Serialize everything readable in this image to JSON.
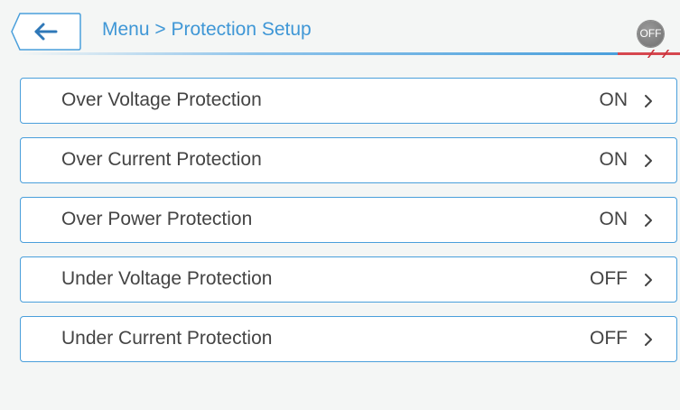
{
  "header": {
    "breadcrumb": "Menu > Protection Setup",
    "power_badge": "OFF",
    "back_icon": "arrow-left-icon"
  },
  "colors": {
    "accent": "#4a9fdb",
    "badge": "#7a7a7a",
    "alert": "#d6474f"
  },
  "items": [
    {
      "label": "Over Voltage Protection",
      "value": "ON"
    },
    {
      "label": "Over Current Protection",
      "value": "ON"
    },
    {
      "label": "Over Power Protection",
      "value": "ON"
    },
    {
      "label": "Under Voltage Protection",
      "value": "OFF"
    },
    {
      "label": "Under Current Protection",
      "value": "OFF"
    }
  ]
}
